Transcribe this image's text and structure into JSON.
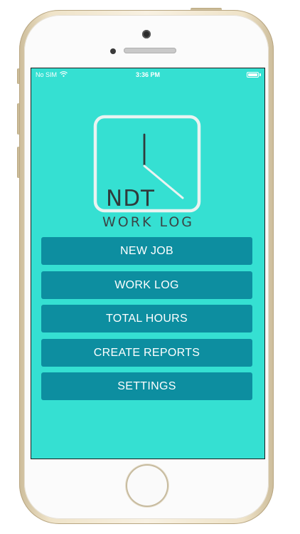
{
  "status_bar": {
    "carrier": "No SIM",
    "time": "3:36 PM",
    "battery_level": 1.0
  },
  "logo": {
    "line1": "NDT",
    "line2": "WORK LOG"
  },
  "menu": {
    "items": [
      {
        "label": "NEW JOB"
      },
      {
        "label": "WORK LOG"
      },
      {
        "label": "TOTAL HOURS"
      },
      {
        "label": "CREATE REPORTS"
      },
      {
        "label": "SETTINGS"
      }
    ]
  },
  "colors": {
    "screen_background": "#35e0d2",
    "button_background": "#0d8ea0",
    "button_text": "#ffffff",
    "logo_outline": "#e9f3f1",
    "logo_text": "#2f3b3c"
  },
  "icons": {
    "wifi": "wifi-icon",
    "battery": "battery-icon",
    "logo_clock": "clock-icon"
  }
}
